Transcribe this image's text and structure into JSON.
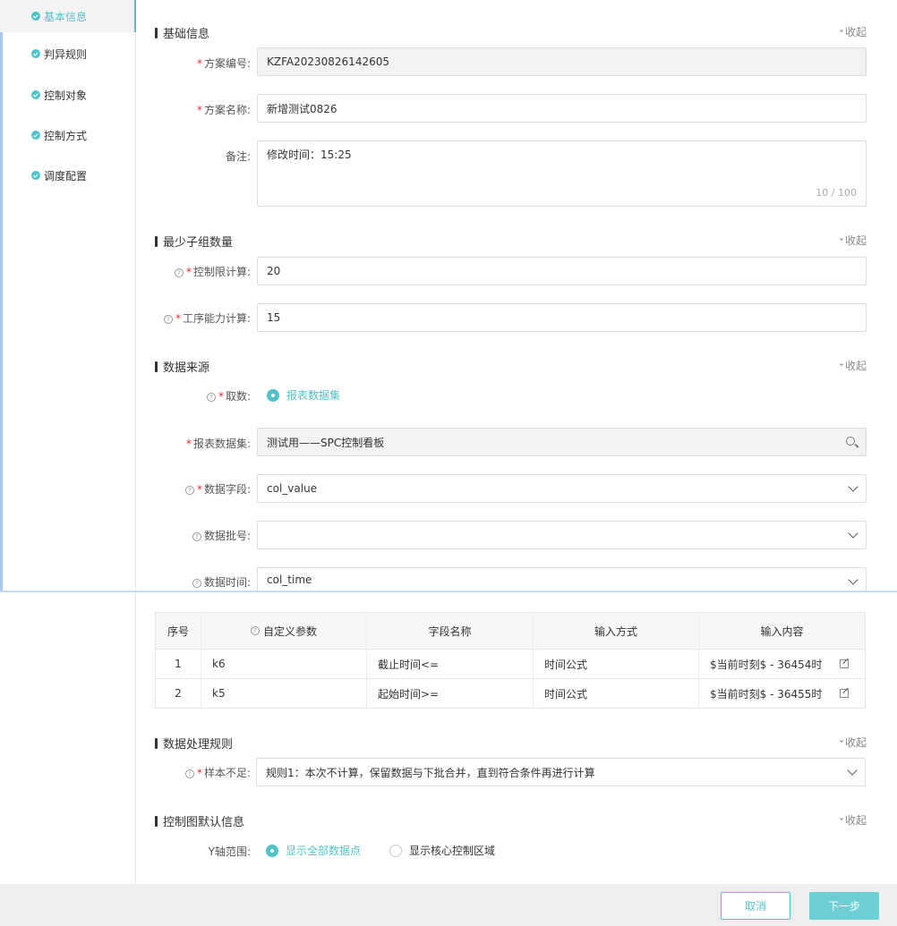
{
  "sidebar": {
    "items": [
      {
        "label": "基本信息"
      },
      {
        "label": "判异规则"
      },
      {
        "label": "控制对象"
      },
      {
        "label": "控制方式"
      },
      {
        "label": "调度配置"
      }
    ]
  },
  "collapse_label": "收起",
  "basic": {
    "title": "基础信息",
    "plan_no_label": "方案编号:",
    "plan_no_value": "KZFA20230826142605",
    "plan_name_label": "方案名称:",
    "plan_name_value": "新增测试0826",
    "remark_label": "备注:",
    "remark_value": "修改时间：15:25",
    "remark_counter": "10 / 100"
  },
  "min_group": {
    "title": "最少子组数量",
    "control_limit_label": "控制限计算:",
    "control_limit_value": "20",
    "capability_label": "工序能力计算:",
    "capability_value": "15"
  },
  "source": {
    "title": "数据来源",
    "fetch_label": "取数:",
    "fetch_option": "报表数据集",
    "dataset_label": "报表数据集:",
    "dataset_value": "测试用——SPC控制看板",
    "field_label": "数据字段:",
    "field_value": "col_value",
    "batch_label": "数据批号:",
    "batch_value": "",
    "time_label": "数据时间:",
    "time_value": "col_time"
  },
  "params_table": {
    "headers": [
      "序号",
      "自定义参数",
      "字段名称",
      "输入方式",
      "输入内容"
    ],
    "rows": [
      {
        "index": "1",
        "param": "k6",
        "field": "截止时间<=",
        "mode": "时间公式",
        "content": "$当前时刻$ - 36454时"
      },
      {
        "index": "2",
        "param": "k5",
        "field": "起始时间>=",
        "mode": "时间公式",
        "content": "$当前时刻$ - 36455时"
      }
    ]
  },
  "processing": {
    "title": "数据处理规则",
    "sample_label": "样本不足:",
    "sample_value": "规则1：本次不计算，保留数据与下批合并，直到符合条件再进行计算"
  },
  "chart_default": {
    "title": "控制图默认信息",
    "y_range_label": "Y轴范围:",
    "option_all": "显示全部数据点",
    "option_core": "显示核心控制区域"
  },
  "footer": {
    "cancel": "取消",
    "next": "下一步"
  },
  "colors": {
    "accent": "#4fc3c9",
    "required": "#f5222d"
  }
}
